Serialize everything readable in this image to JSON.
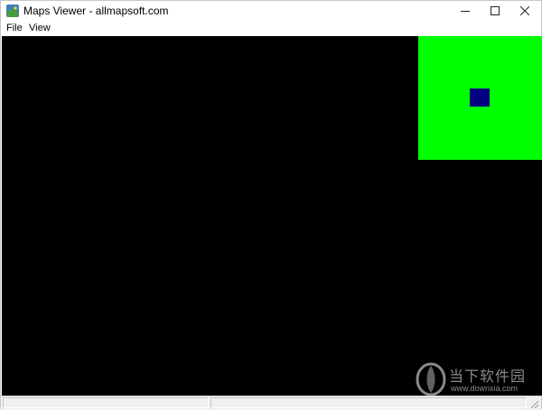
{
  "window": {
    "title": "Maps Viewer - allmapsoft.com",
    "icon": "globe-map-icon",
    "controls": [
      "minimize-icon",
      "maximize-icon",
      "close-icon"
    ]
  },
  "menubar": {
    "items": [
      {
        "label": "File"
      },
      {
        "label": "View"
      }
    ]
  },
  "map": {
    "background_color": "#000000",
    "overview_color": "#00ff00",
    "viewport_marker_color": "#000080"
  },
  "watermark": {
    "title": "当下软件园",
    "url": "www.downxia.com"
  },
  "statusbar": {
    "panes": [
      "",
      ""
    ]
  }
}
